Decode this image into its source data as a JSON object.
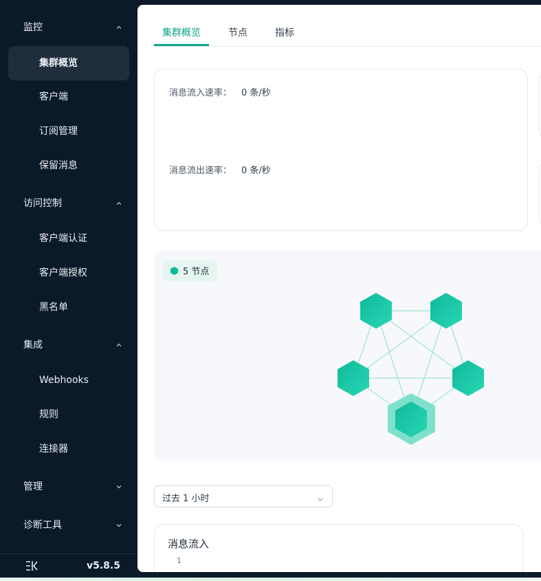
{
  "sidebar": {
    "groups": [
      {
        "title": "监控",
        "expanded": true,
        "items": [
          "集群概览",
          "客户端",
          "订阅管理",
          "保留消息"
        ]
      },
      {
        "title": "访问控制",
        "expanded": true,
        "items": [
          "客户端认证",
          "客户端授权",
          "黑名单"
        ]
      },
      {
        "title": "集成",
        "expanded": true,
        "items": [
          "Webhooks",
          "规则",
          "连接器"
        ]
      },
      {
        "title": "管理",
        "expanded": false,
        "items": []
      },
      {
        "title": "诊断工具",
        "expanded": false,
        "items": []
      }
    ],
    "active_item": "集群概览",
    "version": "v5.8.5",
    "collapse_icon": "collapse-sidebar-icon"
  },
  "tabs": [
    {
      "label": "集群概览",
      "active": true
    },
    {
      "label": "节点",
      "active": false
    },
    {
      "label": "指标",
      "active": false
    }
  ],
  "rates": {
    "in_label": "消息流入速率：",
    "in_value": "0 条/秒",
    "out_label": "消息流出速率：",
    "out_value": "0 条/秒"
  },
  "topology": {
    "node_count_label": "5 节点",
    "node_count": 5
  },
  "time_range": {
    "selected": "过去 1 小时"
  },
  "chart": {
    "title": "消息流入",
    "y_tick": "1"
  },
  "colors": {
    "accent": "#0fa58a",
    "sidebar_bg": "#0b1a29",
    "active_item_bg": "#1f2d3d",
    "node_fill": "#15c39f"
  }
}
